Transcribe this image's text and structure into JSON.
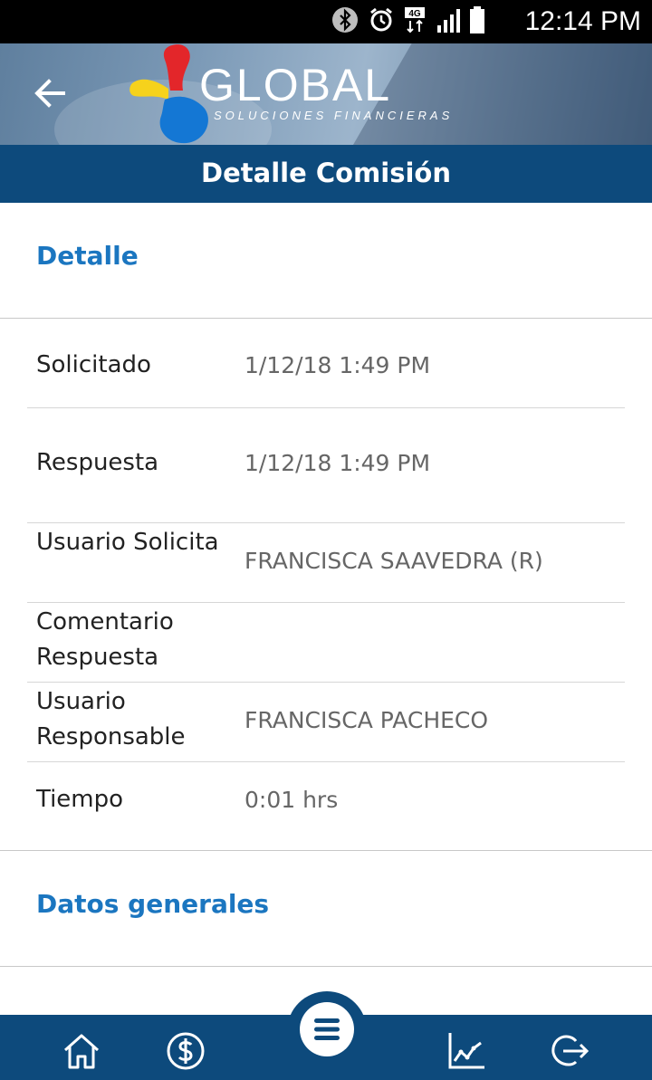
{
  "status_bar": {
    "time": "12:14 PM",
    "icons": [
      "bluetooth-icon",
      "alarm-icon",
      "4g-icon",
      "signal-icon",
      "battery-icon"
    ],
    "network_label": "4G"
  },
  "header": {
    "logo_text": "GLOBAL",
    "logo_tagline": "SOLUCIONES FINANCIERAS",
    "page_title": "Detalle Comisión",
    "colors": {
      "bar": "#0d4a7c",
      "logo_red": "#e3262a",
      "logo_yellow": "#f6d21c",
      "logo_blue": "#1477d4"
    }
  },
  "detalle": {
    "section_title": "Detalle",
    "rows": [
      {
        "label": "Solicitado",
        "value": "1/12/18 1:49 PM"
      },
      {
        "label": "Respuesta",
        "value": "1/12/18 1:49 PM"
      },
      {
        "label": "Usuario Solicita",
        "value": "FRANCISCA SAAVEDRA (R)"
      },
      {
        "label": "Comentario Respuesta",
        "value": ""
      },
      {
        "label": "Usuario Responsable",
        "value": "FRANCISCA PACHECO"
      },
      {
        "label": "Tiempo",
        "value": "0:01 hrs"
      }
    ]
  },
  "datos_generales": {
    "section_title": "Datos generales"
  },
  "bottom_nav": {
    "items": [
      "home-icon",
      "dollar-icon",
      "menu-icon",
      "chart-icon",
      "logout-icon"
    ],
    "accent": "#1b76c0"
  }
}
